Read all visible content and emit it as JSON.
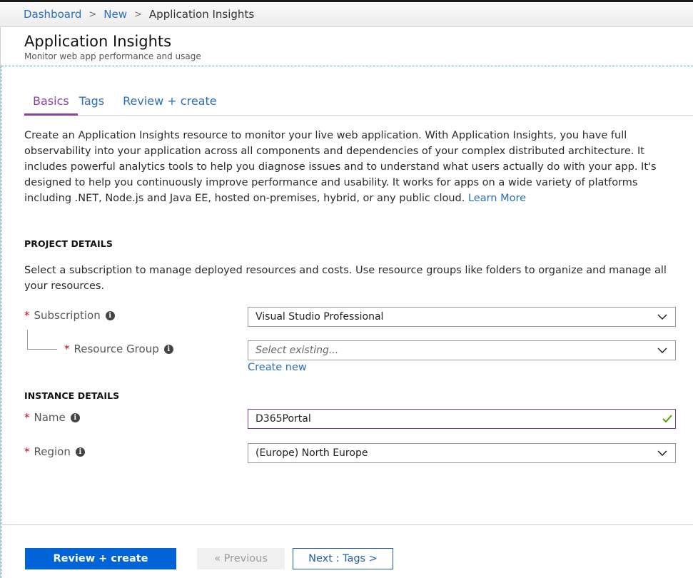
{
  "breadcrumb": {
    "items": [
      {
        "label": "Dashboard",
        "link": true
      },
      {
        "label": "New",
        "link": true
      },
      {
        "label": "Application Insights",
        "link": false
      }
    ],
    "separator": ">"
  },
  "header": {
    "title": "Application Insights",
    "subtitle": "Monitor web app performance and usage"
  },
  "tabs": [
    {
      "label": "Basics",
      "active": true
    },
    {
      "label": "Tags",
      "active": false
    },
    {
      "label": "Review + create",
      "active": false
    }
  ],
  "intro": {
    "text": "Create an Application Insights resource to monitor your live web application. With Application Insights, you have full observability into your application across all components and dependencies of your complex distributed architecture. It includes powerful analytics tools to help you diagnose issues and to understand what users actually do with your app. It's designed to help you continuously improve performance and usability. It works for apps on a wide variety of platforms including .NET, Node.js and Java EE, hosted on-premises, hybrid, or any public cloud.",
    "link_label": "Learn More"
  },
  "project_details": {
    "title": "PROJECT DETAILS",
    "description": "Select a subscription to manage deployed resources and costs. Use resource groups like folders to organize and manage all your resources.",
    "subscription": {
      "label": "Subscription",
      "required_mark": "*",
      "value": "Visual Studio Professional"
    },
    "resource_group": {
      "label": "Resource Group",
      "required_mark": "*",
      "placeholder": "Select existing...",
      "create_new_label": "Create new"
    }
  },
  "instance_details": {
    "title": "INSTANCE DETAILS",
    "name": {
      "label": "Name",
      "required_mark": "*",
      "value": "D365Portal",
      "valid": true
    },
    "region": {
      "label": "Region",
      "required_mark": "*",
      "value": "(Europe) North Europe"
    }
  },
  "footer": {
    "review_create_label": "Review + create",
    "previous_label": "« Previous",
    "next_label": "Next : Tags >"
  },
  "colors": {
    "accent_purple": "#8a3ea6",
    "link_blue": "#2a6ebb",
    "primary_button": "#0063d8",
    "required_red": "#d0021b",
    "valid_green": "#57a300"
  }
}
